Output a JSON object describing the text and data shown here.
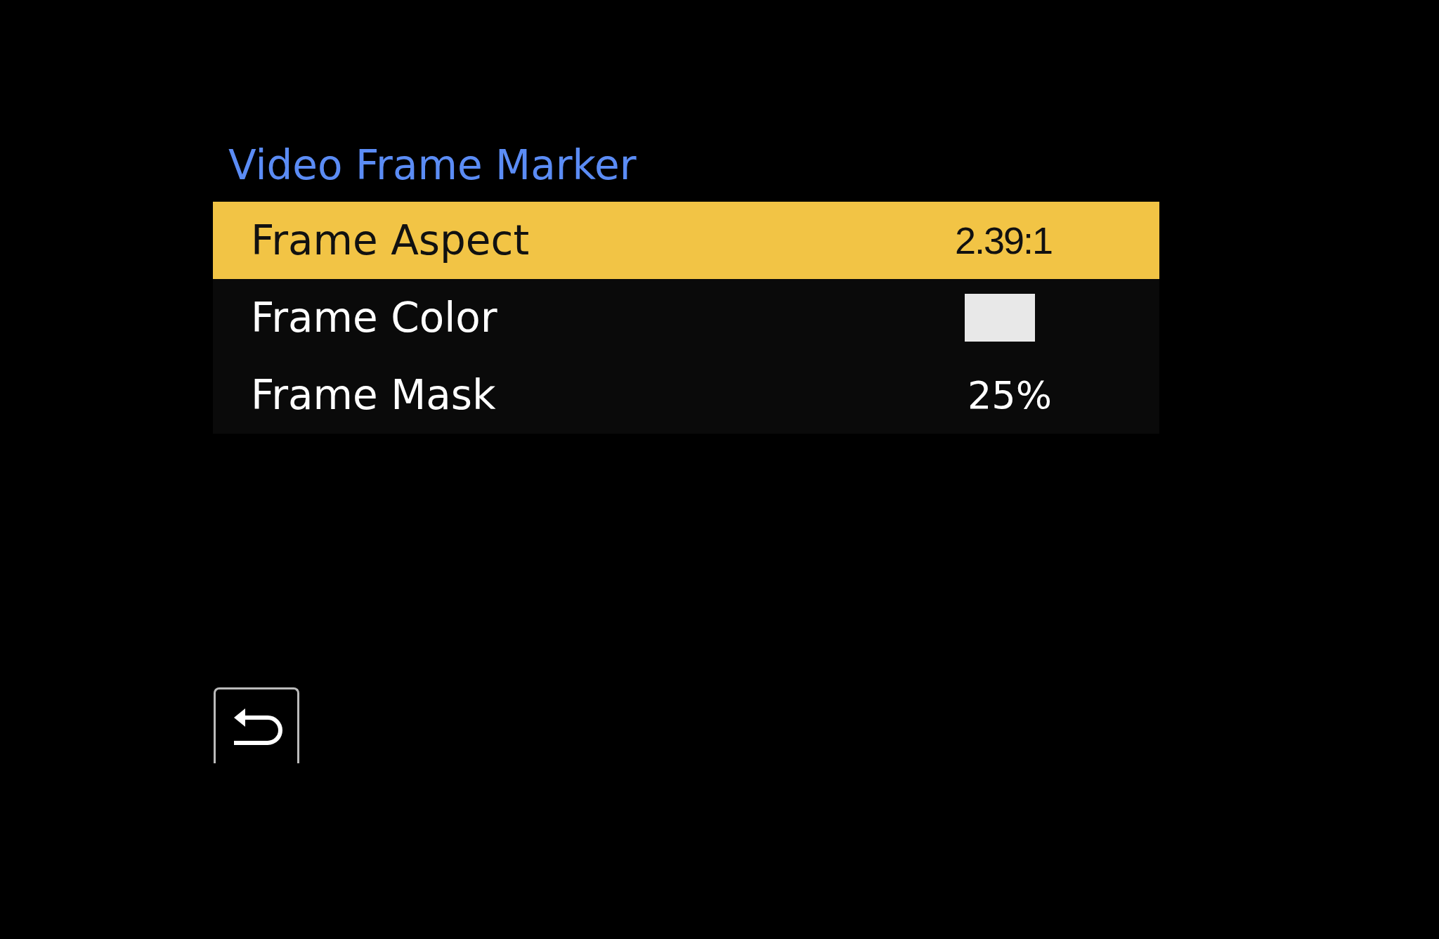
{
  "title": "Video Frame Marker",
  "items": [
    {
      "label": "Frame Aspect",
      "kind": "text",
      "value": "2.39:1",
      "selected": true
    },
    {
      "label": "Frame Color",
      "kind": "color",
      "color": "#e8e8e8",
      "selected": false
    },
    {
      "label": "Frame Mask",
      "kind": "text",
      "value": "25%",
      "selected": false
    }
  ],
  "back_button": {
    "selected": false
  }
}
